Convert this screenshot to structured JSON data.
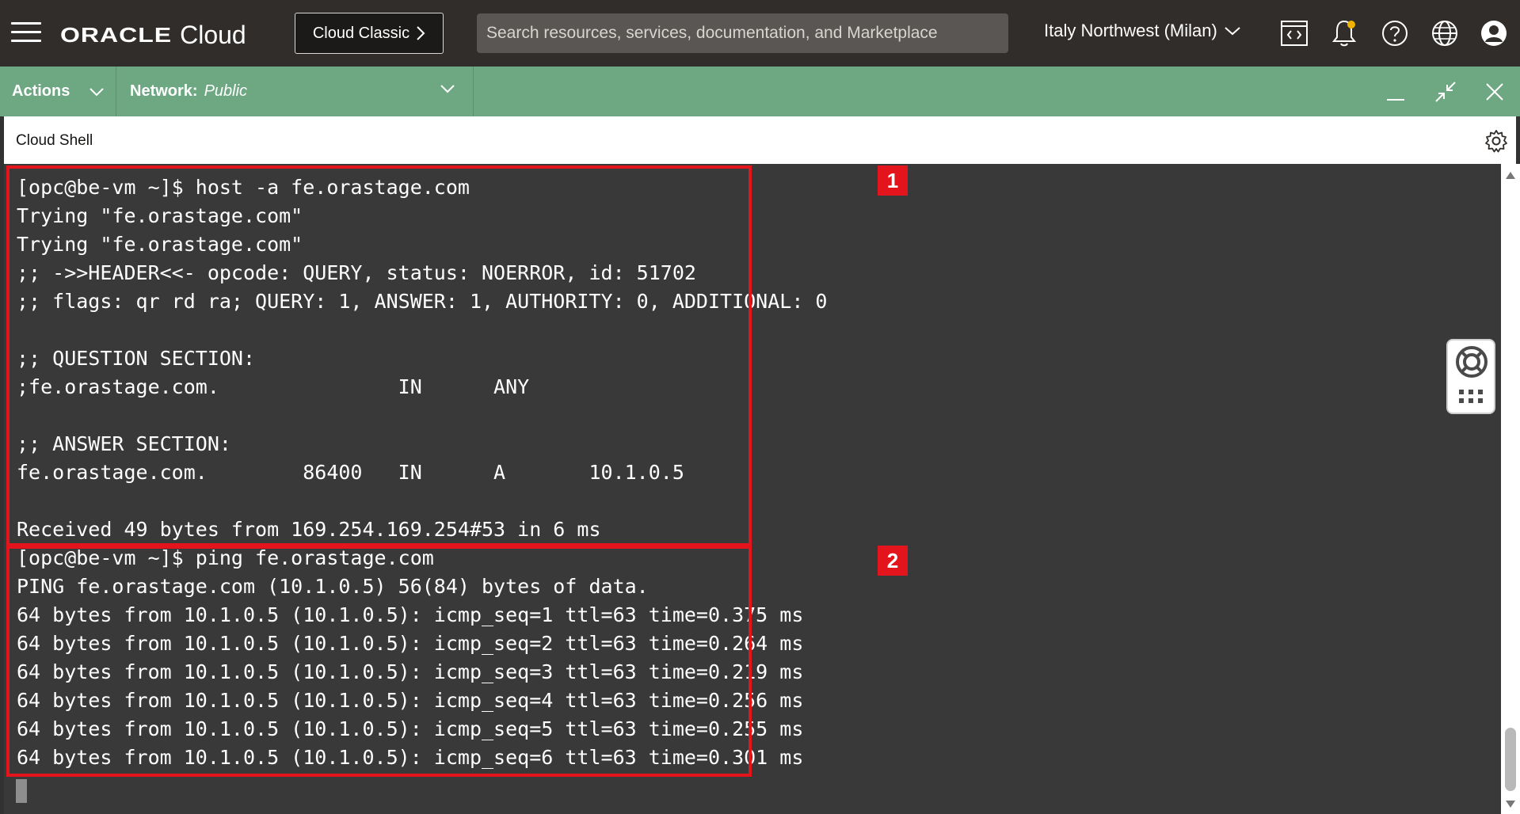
{
  "header": {
    "logo_oracle": "ORACLE",
    "logo_cloud": "Cloud",
    "classic_button": "Cloud Classic",
    "search_placeholder": "Search resources, services, documentation, and Marketplace",
    "region": "Italy Northwest (Milan)"
  },
  "shell_bar": {
    "actions_label": "Actions",
    "network_label": "Network:",
    "network_value": "Public"
  },
  "shell": {
    "title": "Cloud Shell"
  },
  "terminal": {
    "lines": [
      "[opc@be-vm ~]$ host -a fe.orastage.com",
      "Trying \"fe.orastage.com\"",
      "Trying \"fe.orastage.com\"",
      ";; ->>HEADER<<- opcode: QUERY, status: NOERROR, id: 51702",
      ";; flags: qr rd ra; QUERY: 1, ANSWER: 1, AUTHORITY: 0, ADDITIONAL: 0",
      "",
      ";; QUESTION SECTION:",
      ";fe.orastage.com.               IN      ANY",
      "",
      ";; ANSWER SECTION:",
      "fe.orastage.com.        86400   IN      A       10.1.0.5",
      "",
      "Received 49 bytes from 169.254.169.254#53 in 6 ms",
      "[opc@be-vm ~]$ ping fe.orastage.com",
      "PING fe.orastage.com (10.1.0.5) 56(84) bytes of data.",
      "64 bytes from 10.1.0.5 (10.1.0.5): icmp_seq=1 ttl=63 time=0.375 ms",
      "64 bytes from 10.1.0.5 (10.1.0.5): icmp_seq=2 ttl=63 time=0.264 ms",
      "64 bytes from 10.1.0.5 (10.1.0.5): icmp_seq=3 ttl=63 time=0.219 ms",
      "64 bytes from 10.1.0.5 (10.1.0.5): icmp_seq=4 ttl=63 time=0.256 ms",
      "64 bytes from 10.1.0.5 (10.1.0.5): icmp_seq=5 ttl=63 time=0.255 ms",
      "64 bytes from 10.1.0.5 (10.1.0.5): icmp_seq=6 ttl=63 time=0.301 ms"
    ]
  },
  "annotations": {
    "box1_label": "1",
    "box2_label": "2"
  },
  "colors": {
    "topbar": "#312d2a",
    "shellbar": "#6ea883",
    "terminal_bg": "#393939",
    "highlight": "#e3141c"
  }
}
